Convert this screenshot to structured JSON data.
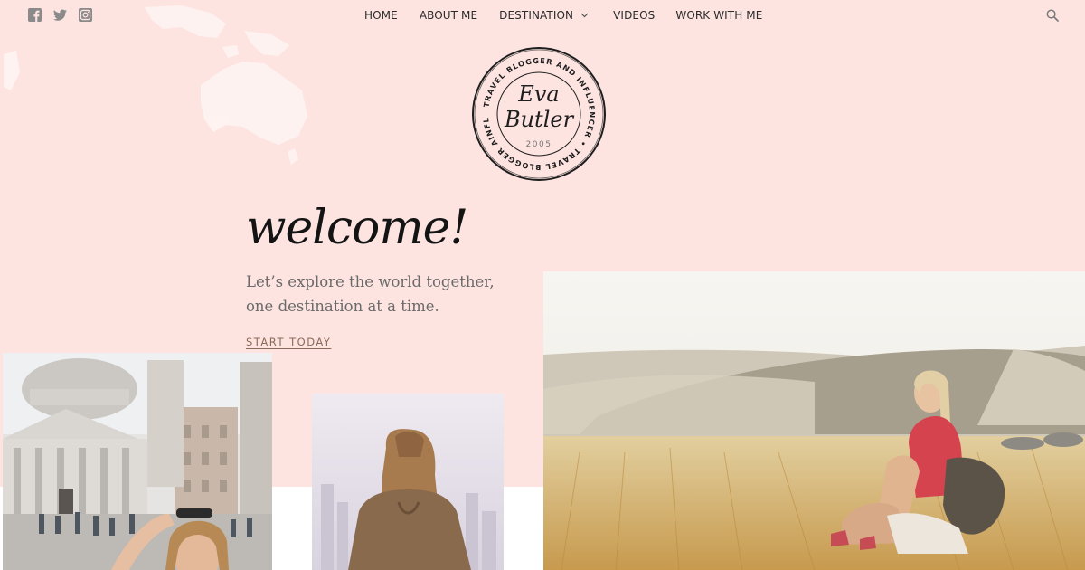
{
  "colors": {
    "hero_background": "#fde4e1",
    "nav_text": "#2b2b2b",
    "cta_text": "#8a6a58",
    "tagline_text": "#6a6a6a",
    "social_icon": "#8a8a8a"
  },
  "social": [
    {
      "name": "facebook-icon"
    },
    {
      "name": "twitter-icon"
    },
    {
      "name": "instagram-icon"
    }
  ],
  "nav": {
    "home": "HOME",
    "about": "ABOUT ME",
    "destination": "DESTINATION",
    "videos": "VIDEOS",
    "work": "WORK WITH ME"
  },
  "logo": {
    "name_line1": "Eva",
    "name_line2": "Butler",
    "year": "2005",
    "ring_text": "TRAVEL BLOGGER AND INFLUENCER • TRAVEL BLOGGER AINFLUEN CER •"
  },
  "hero": {
    "welcome": "welcome!",
    "tagline_line1": "Let’s explore the world together,",
    "tagline_line2": "one destination at a time.",
    "cta": "START TODAY"
  },
  "photos": {
    "rome": "photo-rome-woman",
    "back": "photo-woman-back",
    "field": "photo-wheat-field"
  }
}
